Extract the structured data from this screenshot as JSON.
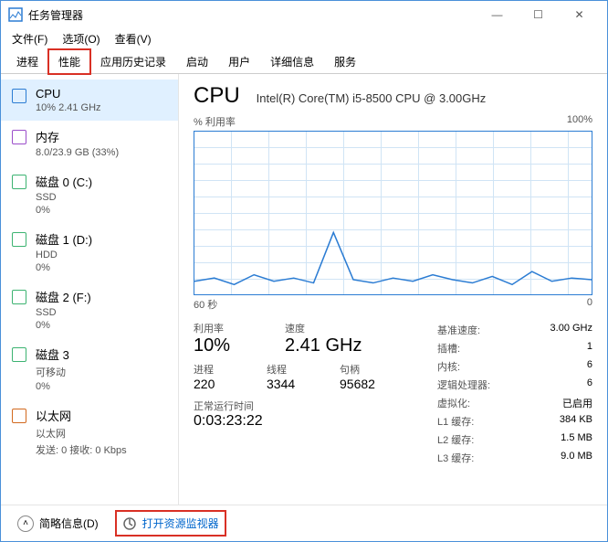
{
  "window": {
    "title": "任务管理器"
  },
  "menu": {
    "file": "文件(F)",
    "options": "选项(O)",
    "view": "查看(V)"
  },
  "tabs": [
    {
      "label": "进程"
    },
    {
      "label": "性能"
    },
    {
      "label": "应用历史记录"
    },
    {
      "label": "启动"
    },
    {
      "label": "用户"
    },
    {
      "label": "详细信息"
    },
    {
      "label": "服务"
    }
  ],
  "sidebar": [
    {
      "name": "CPU",
      "sub": "10% 2.41 GHz",
      "color": "blue",
      "selected": true
    },
    {
      "name": "内存",
      "sub": "8.0/23.9 GB (33%)",
      "color": "purple"
    },
    {
      "name": "磁盘 0 (C:)",
      "sub": "SSD",
      "sub2": "0%",
      "color": "green"
    },
    {
      "name": "磁盘 1 (D:)",
      "sub": "HDD",
      "sub2": "0%",
      "color": "green"
    },
    {
      "name": "磁盘 2 (F:)",
      "sub": "SSD",
      "sub2": "0%",
      "color": "green"
    },
    {
      "name": "磁盘 3",
      "sub": "可移动",
      "sub2": "0%",
      "color": "green"
    },
    {
      "name": "以太网",
      "sub": "以太网",
      "sub2": "发送: 0 接收: 0 Kbps",
      "color": "orange"
    }
  ],
  "main": {
    "title": "CPU",
    "subtitle": "Intel(R) Core(TM) i5-8500 CPU @ 3.00GHz",
    "chart_ylabel": "% 利用率",
    "chart_ymax": "100%",
    "chart_xlabel": "60 秒",
    "chart_xmax": "0",
    "stats1": {
      "util_lab": "利用率",
      "util": "10%",
      "speed_lab": "速度",
      "speed": "2.41 GHz"
    },
    "stats2": {
      "proc_lab": "进程",
      "proc": "220",
      "thread_lab": "线程",
      "thread": "3344",
      "handle_lab": "句柄",
      "handle": "95682"
    },
    "uptime_lab": "正常运行时间",
    "uptime": "0:03:23:22",
    "right": [
      {
        "lab": "基准速度:",
        "val": "3.00 GHz"
      },
      {
        "lab": "插槽:",
        "val": "1"
      },
      {
        "lab": "内核:",
        "val": "6"
      },
      {
        "lab": "逻辑处理器:",
        "val": "6"
      },
      {
        "lab": "虚拟化:",
        "val": "已启用"
      },
      {
        "lab": "L1 缓存:",
        "val": "384 KB"
      },
      {
        "lab": "L2 缓存:",
        "val": "1.5 MB"
      },
      {
        "lab": "L3 缓存:",
        "val": "9.0 MB"
      }
    ]
  },
  "footer": {
    "brief": "简略信息(D)",
    "resmon": "打开资源监视器"
  },
  "chart_data": {
    "type": "line",
    "title": "% 利用率",
    "xlabel": "60 秒",
    "ylabel": "% 利用率",
    "ylim": [
      0,
      100
    ],
    "x": [
      60,
      57,
      54,
      51,
      48,
      45,
      42,
      39,
      36,
      33,
      30,
      27,
      24,
      21,
      18,
      15,
      12,
      9,
      6,
      3,
      0
    ],
    "values": [
      8,
      10,
      6,
      12,
      8,
      10,
      7,
      38,
      9,
      7,
      10,
      8,
      12,
      9,
      7,
      11,
      6,
      14,
      8,
      10,
      9
    ]
  }
}
